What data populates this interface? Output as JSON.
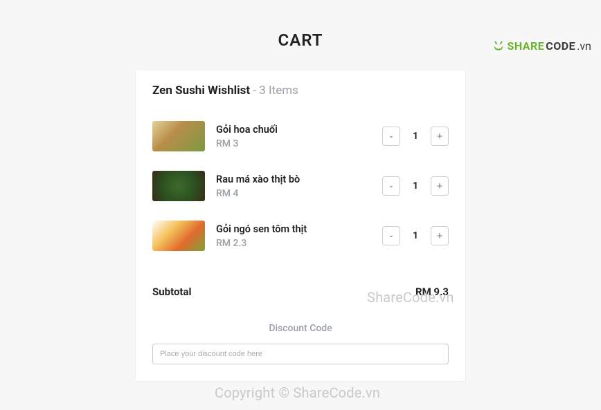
{
  "brand": {
    "share": "SHARE",
    "code": "CODE",
    "vn": ".vn"
  },
  "page": {
    "title": "CART"
  },
  "wishlist": {
    "title": "Zen Sushi Wishlist",
    "count_label": "- 3 Items"
  },
  "items": [
    {
      "name": "Gỏi hoa chuối",
      "price": "RM 3",
      "qty": "1"
    },
    {
      "name": "Rau má xào thịt bò",
      "price": "RM 4",
      "qty": "1"
    },
    {
      "name": "Gỏi ngó sen tôm thịt",
      "price": "RM 2.3",
      "qty": "1"
    }
  ],
  "qty_buttons": {
    "minus": "-",
    "plus": "+"
  },
  "subtotal": {
    "label": "Subtotal",
    "value": "RM 9.3"
  },
  "discount": {
    "title": "Discount Code",
    "placeholder": "Place your discount code here"
  },
  "watermarks": {
    "wm1": "ShareCode.vn",
    "wm2": "Copyright © ShareCode.vn"
  }
}
